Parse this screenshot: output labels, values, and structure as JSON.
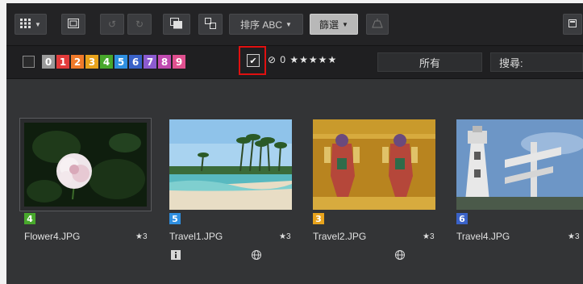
{
  "toolbar": {
    "sort_label": "排序 ABC",
    "filter_label": "篩選"
  },
  "filterbar": {
    "color_labels": [
      {
        "text": "0",
        "color": "#9a9a9a"
      },
      {
        "text": "1",
        "color": "#e23b3b"
      },
      {
        "text": "2",
        "color": "#f07a2a"
      },
      {
        "text": "3",
        "color": "#e8a31c"
      },
      {
        "text": "4",
        "color": "#48a82c"
      },
      {
        "text": "5",
        "color": "#2f8fe0"
      },
      {
        "text": "6",
        "color": "#3a62c8"
      },
      {
        "text": "7",
        "color": "#8c5bd0"
      },
      {
        "text": "8",
        "color": "#c04ab0"
      },
      {
        "text": "9",
        "color": "#e0508f"
      }
    ],
    "checkbox_mark": "✔",
    "rating_icons": "⊘ 0",
    "stars": "★★★★★",
    "dropdown_value": "所有",
    "search_label": "搜尋:"
  },
  "images": [
    {
      "filename": "Flower4.JPG",
      "label": "4",
      "label_color": "#48a82c",
      "rating": "★3"
    },
    {
      "filename": "Travel1.JPG",
      "label": "5",
      "label_color": "#2f8fe0",
      "rating": "★3"
    },
    {
      "filename": "Travel2.JPG",
      "label": "3",
      "label_color": "#e8a31c",
      "rating": "★3"
    },
    {
      "filename": "Travel4.JPG",
      "label": "6",
      "label_color": "#3a62c8",
      "rating": "★3"
    }
  ]
}
